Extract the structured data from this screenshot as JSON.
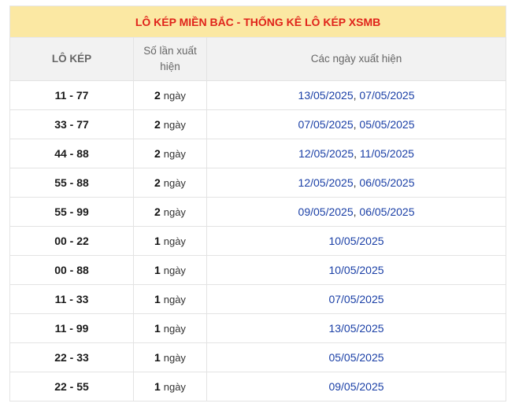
{
  "title": "LÔ KÉP MIỀN BẮC - THỐNG KÊ LÔ KÉP XSMB",
  "headers": {
    "pair": "LÔ KÉP",
    "count_line1": "Số lần xuất",
    "count_line2": "hiện",
    "dates": "Các ngày xuất hiện"
  },
  "unit_label": "ngày",
  "rows": [
    {
      "pair": "11 - 77",
      "count": "2",
      "dates": [
        "13/05/2025",
        "07/05/2025"
      ]
    },
    {
      "pair": "33 - 77",
      "count": "2",
      "dates": [
        "07/05/2025",
        "05/05/2025"
      ]
    },
    {
      "pair": "44 - 88",
      "count": "2",
      "dates": [
        "12/05/2025",
        "11/05/2025"
      ]
    },
    {
      "pair": "55 - 88",
      "count": "2",
      "dates": [
        "12/05/2025",
        "06/05/2025"
      ]
    },
    {
      "pair": "55 - 99",
      "count": "2",
      "dates": [
        "09/05/2025",
        "06/05/2025"
      ]
    },
    {
      "pair": "00 - 22",
      "count": "1",
      "dates": [
        "10/05/2025"
      ]
    },
    {
      "pair": "00 - 88",
      "count": "1",
      "dates": [
        "10/05/2025"
      ]
    },
    {
      "pair": "11 - 33",
      "count": "1",
      "dates": [
        "07/05/2025"
      ]
    },
    {
      "pair": "11 - 99",
      "count": "1",
      "dates": [
        "13/05/2025"
      ]
    },
    {
      "pair": "22 - 33",
      "count": "1",
      "dates": [
        "05/05/2025"
      ]
    },
    {
      "pair": "22 - 55",
      "count": "1",
      "dates": [
        "09/05/2025"
      ]
    }
  ],
  "colors": {
    "title_text": "#e0241b",
    "title_bg": "#fbe8a3",
    "header_bg": "#f2f2f2",
    "date_link": "#1a3fa6"
  }
}
